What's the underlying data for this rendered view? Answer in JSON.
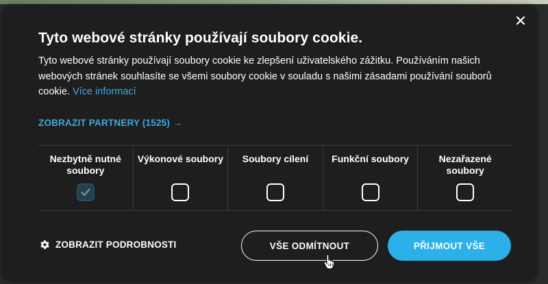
{
  "dialog": {
    "title": "Tyto webové stránky používají soubory cookie.",
    "description": "Tyto webové stránky používají soubory cookie ke zlepšení uživatelského zážitku. Používáním našich webových stránek souhlasíte se všemi soubory cookie v souladu s našimi zásadami používání souborů cookie.",
    "more_info_link": "Více informací",
    "partners_link": "ZOBRAZIT PARTNERY (1525) →",
    "close_icon": "close-icon"
  },
  "categories": [
    {
      "label": "Nezbytně nutné soubory",
      "checked": true,
      "disabled": true
    },
    {
      "label": "Výkonové soubory",
      "checked": false
    },
    {
      "label": "Soubory cílení",
      "checked": false
    },
    {
      "label": "Funkční soubory",
      "checked": false
    },
    {
      "label": "Nezařazené soubory",
      "checked": false
    }
  ],
  "footer": {
    "details_label": "ZOBRAZIT PODROBNOSTI",
    "details_icon": "gear-icon",
    "reject_label": "VŠE ODMÍTNOUT",
    "accept_label": "PŘIJMOUT VŠE"
  },
  "colors": {
    "background": "#1e1e1e",
    "accent": "#2bb0ea",
    "link": "#3fa9de"
  }
}
